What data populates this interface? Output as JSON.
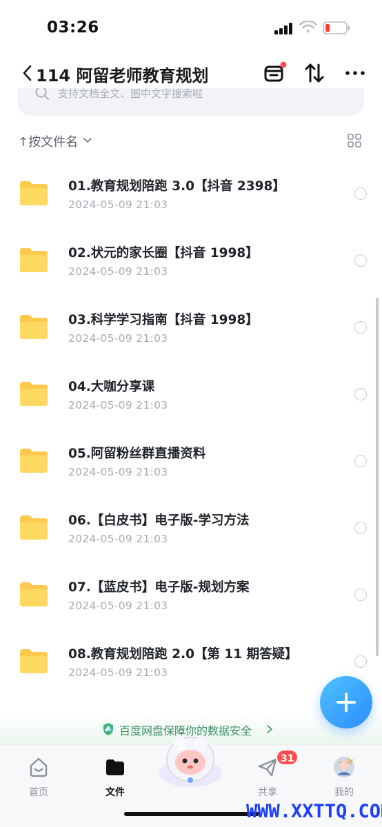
{
  "status_bar": {
    "time": "03:26"
  },
  "header": {
    "back_label": "<",
    "title": "114 阿留老师教育规划"
  },
  "search": {
    "placeholder": "支持文档全文、图中文字搜索啦"
  },
  "sort": {
    "label": "↑按文件名"
  },
  "files": [
    {
      "name": "01.教育规划陪跑 3.0【抖音 2398】",
      "date": "2024-05-09 21:03"
    },
    {
      "name": "02.状元的家长圈【抖音 1998】",
      "date": "2024-05-09 21:03"
    },
    {
      "name": "03.科学学习指南【抖音 1998】",
      "date": "2024-05-09 21:03"
    },
    {
      "name": "04.大咖分享课",
      "date": "2024-05-09 21:03"
    },
    {
      "name": "05.阿留粉丝群直播资料",
      "date": "2024-05-09 21:03"
    },
    {
      "name": "06.【白皮书】电子版-学习方法",
      "date": "2024-05-09 21:03"
    },
    {
      "name": "07.【蓝皮书】电子版-规划方案",
      "date": "2024-05-09 21:03"
    },
    {
      "name": "08.教育规划陪跑 2.0【第 11 期答疑】",
      "date": "2024-05-09 21:03"
    }
  ],
  "safety_banner": {
    "text": "百度网盘保障你的数据安全"
  },
  "tabs": [
    {
      "label": "首页",
      "icon": "home-icon",
      "active": false
    },
    {
      "label": "文件",
      "icon": "folder-icon",
      "active": true
    },
    {
      "label": "共享",
      "icon": "share-icon",
      "active": false,
      "badge": "31"
    },
    {
      "label": "我的",
      "icon": "avatar-icon",
      "active": false
    }
  ],
  "watermark": "WWW.XXTTQ.COM",
  "colors": {
    "accent": "#2b8cff",
    "folder": "#ffcc33",
    "badge": "#ff4d4f",
    "safe": "#3f8f64"
  }
}
